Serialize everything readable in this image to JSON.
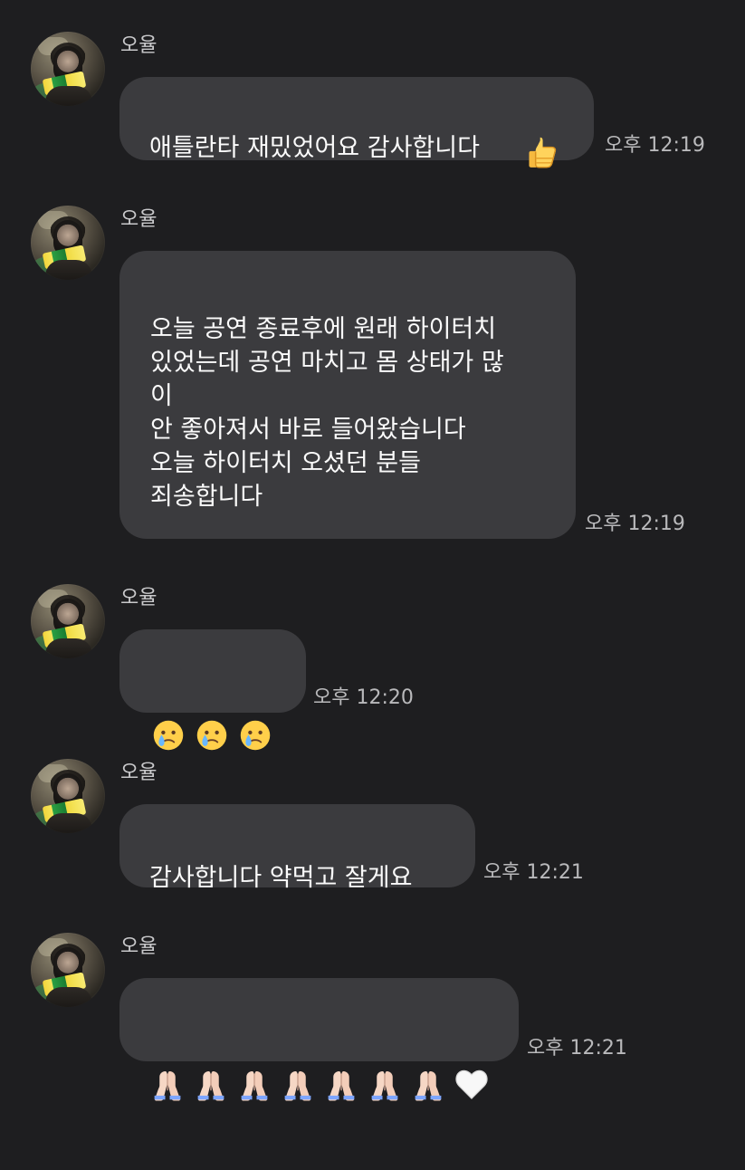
{
  "messages": [
    {
      "sender": "오율",
      "text": "애틀란타 재밌었어요 감사합니다",
      "time": "오후 12:19",
      "emoji": "thumbs-up"
    },
    {
      "sender": "오율",
      "text": "오늘 공연 종료후에 원래 하이터치\n있었는데 공연 마치고 몸 상태가 많\n이\n안 좋아져서 바로 들어왔습니다\n오늘 하이터치 오셨던 분들\n죄송합니다",
      "time": "오후 12:19"
    },
    {
      "sender": "오율",
      "time": "오후 12:20",
      "emojis": [
        "crying-face",
        "crying-face",
        "crying-face"
      ]
    },
    {
      "sender": "오율",
      "text": "감사합니다 약먹고 잘게요",
      "time": "오후 12:21"
    },
    {
      "sender": "오율",
      "time": "오후 12:21",
      "emojis": [
        "folded-hands",
        "folded-hands",
        "folded-hands",
        "folded-hands",
        "folded-hands",
        "folded-hands",
        "folded-hands",
        "white-heart"
      ]
    }
  ]
}
